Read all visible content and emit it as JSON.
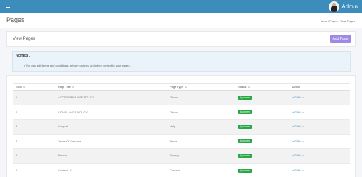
{
  "topbar": {
    "user_name": "Admin"
  },
  "header": {
    "title": "Pages",
    "breadcrumb": "Home  /  Pages  /  View Pages"
  },
  "card": {
    "title": "View Pages",
    "add_button": "Add Page"
  },
  "notes": {
    "title": "NOTES :",
    "text": "•  You can add terms and conditions, privacy policies and other content to your pages."
  },
  "table": {
    "headers": [
      "S.No",
      "Page Title",
      "Page Type",
      "Status",
      "Action"
    ],
    "rows": [
      {
        "sno": "1",
        "title": "ACCEPTABLE USE POLICY",
        "type": "Others",
        "status": "Approved",
        "action": "Action"
      },
      {
        "sno": "2",
        "title": "COMPLAINTS POLICY",
        "type": "Others",
        "status": "Approved",
        "action": "Action"
      },
      {
        "sno": "3",
        "title": "Support",
        "type": "Help",
        "status": "Approved",
        "action": "Action"
      },
      {
        "sno": "4",
        "title": "Terms Of Services",
        "type": "Terms",
        "status": "Approved",
        "action": "Action"
      },
      {
        "sno": "5",
        "title": "Privacy",
        "type": "Privacy",
        "status": "Approved",
        "action": "Action"
      },
      {
        "sno": "6",
        "title": "Contact Us",
        "type": "Contact",
        "status": "Approved",
        "action": "Action"
      }
    ]
  },
  "colors": {
    "topbar": "#3c8dbc",
    "add_button": "#9e8ae4",
    "approved": "#28a745",
    "action_link": "#3c8dbc"
  }
}
